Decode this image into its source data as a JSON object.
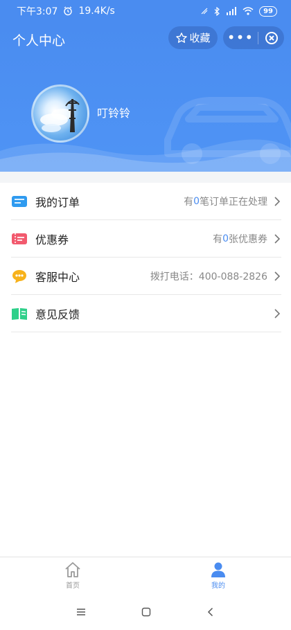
{
  "status_bar": {
    "time": "下午3:07",
    "speed": "19.4K/s",
    "battery": "99"
  },
  "header": {
    "title": "个人中心",
    "favorite_label": "收藏",
    "more_label": "•••"
  },
  "profile": {
    "username": "叮铃铃"
  },
  "menu": [
    {
      "label": "我的订单",
      "info_prefix": "有",
      "info_num": "0",
      "info_suffix": "笔订单正在处理",
      "icon": "ticket-icon",
      "color": "#2f9bf0"
    },
    {
      "label": "优惠券",
      "info_prefix": "有",
      "info_num": "0",
      "info_suffix": "张优惠券",
      "icon": "coupon-icon",
      "color": "#f25a6e"
    },
    {
      "label": "客服中心",
      "info_prefix": "",
      "info_num": "",
      "info_suffix": "拨打电话：400-088-2826",
      "icon": "chat-icon",
      "color": "#f7b21b"
    },
    {
      "label": "意见反馈",
      "info_prefix": "",
      "info_num": "",
      "info_suffix": "",
      "icon": "book-icon",
      "color": "#2fd08a"
    }
  ],
  "tabbar": {
    "home_label": "首页",
    "mine_label": "我的"
  },
  "colors": {
    "primary": "#4a8cf0",
    "divider": "#e8e8e8"
  }
}
